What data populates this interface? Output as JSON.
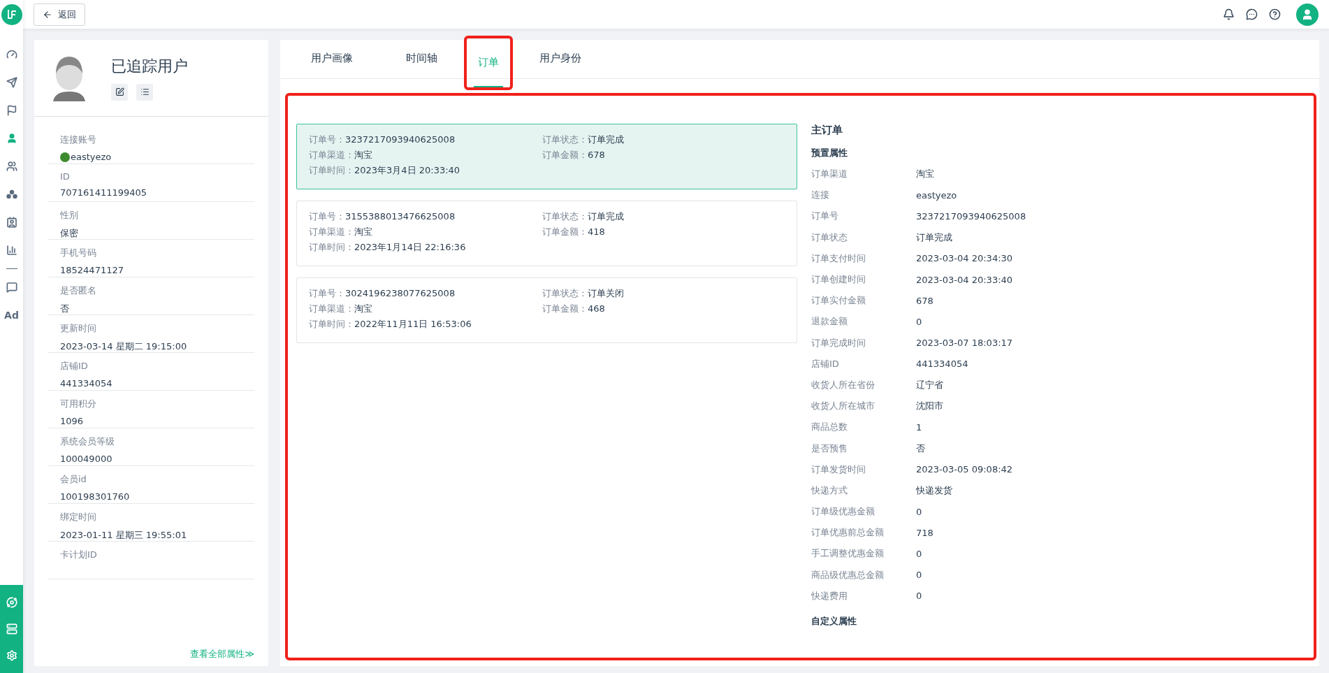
{
  "topbar": {
    "back_button": "返回"
  },
  "nav": {
    "items": [
      {
        "kind": "dashboard",
        "selected": false
      },
      {
        "kind": "send",
        "selected": false
      },
      {
        "kind": "flag",
        "selected": false
      },
      {
        "kind": "user",
        "selected": true
      },
      {
        "kind": "users",
        "selected": false
      },
      {
        "kind": "clusters",
        "selected": false
      },
      {
        "kind": "contact",
        "selected": false
      },
      {
        "kind": "chart",
        "selected": false
      },
      {
        "kind": "divider"
      },
      {
        "kind": "chat",
        "selected": false
      },
      {
        "kind": "text",
        "label": "Ad",
        "selected": false
      }
    ],
    "bottom_items": [
      {
        "kind": "network"
      },
      {
        "kind": "server"
      },
      {
        "kind": "settings"
      }
    ]
  },
  "profile": {
    "title": "已追踪用户",
    "attributes": [
      {
        "label": "连接账号",
        "value": "eastyezo",
        "kind": "account"
      },
      {
        "label": "ID",
        "value": "707161411199405"
      },
      {
        "label": "性别",
        "value": "保密"
      },
      {
        "label": "手机号码",
        "value": "18524471127"
      },
      {
        "label": "是否匿名",
        "value": "否"
      },
      {
        "label": "更新时间",
        "value": "2023-03-14 星期二 19:15:00"
      },
      {
        "label": "店铺ID",
        "value": "441334054"
      },
      {
        "label": "可用积分",
        "value": "1096"
      },
      {
        "label": "系统会员等级",
        "value": "100049000"
      },
      {
        "label": "会员id",
        "value": "100198301760"
      },
      {
        "label": "绑定时间",
        "value": "2023-01-11 星期三 19:55:01"
      },
      {
        "label": "卡计划ID"
      }
    ],
    "view_all": "查看全部属性≫"
  },
  "tabs": [
    {
      "label": "用户画像",
      "selected": false,
      "highlighted": false
    },
    {
      "label": "时间轴",
      "selected": false,
      "highlighted": false
    },
    {
      "label": "订单",
      "selected": true,
      "highlighted": true
    },
    {
      "label": "用户身份",
      "selected": false,
      "highlighted": false
    }
  ],
  "content": {
    "highlighted": true,
    "orders": [
      {
        "selected": true,
        "fields": [
          {
            "label": "订单号：",
            "value": "3237217093940625008"
          },
          {
            "label": "订单状态：",
            "value": "订单完成"
          },
          {
            "label": "订单渠道：",
            "value": "淘宝"
          },
          {
            "label": "订单金额：",
            "value": "678"
          },
          {
            "label": "订单时间：",
            "value": "2023年3月4日 20:33:40"
          }
        ]
      },
      {
        "selected": false,
        "fields": [
          {
            "label": "订单号：",
            "value": "3155388013476625008"
          },
          {
            "label": "订单状态：",
            "value": "订单完成"
          },
          {
            "label": "订单渠道：",
            "value": "淘宝"
          },
          {
            "label": "订单金额：",
            "value": "418"
          },
          {
            "label": "订单时间：",
            "value": "2023年1月14日 22:16:36"
          }
        ]
      },
      {
        "selected": false,
        "fields": [
          {
            "label": "订单号：",
            "value": "3024196238077625008"
          },
          {
            "label": "订单状态：",
            "value": "订单关闭"
          },
          {
            "label": "订单渠道：",
            "value": "淘宝"
          },
          {
            "label": "订单金额：",
            "value": "468"
          },
          {
            "label": "订单时间：",
            "value": "2022年11月11日 16:53:06"
          }
        ]
      }
    ],
    "detail": {
      "title": "主订单",
      "preset_heading": "预置属性",
      "rows": [
        {
          "label": "订单渠道",
          "value": "淘宝"
        },
        {
          "label": "连接",
          "value": "eastyezo"
        },
        {
          "label": "订单号",
          "value": "3237217093940625008"
        },
        {
          "label": "订单状态",
          "value": "订单完成"
        },
        {
          "label": "订单支付时间",
          "value": "2023-03-04 20:34:30"
        },
        {
          "label": "订单创建时间",
          "value": "2023-03-04 20:33:40"
        },
        {
          "label": "订单实付金额",
          "value": "678"
        },
        {
          "label": "退款金额",
          "value": "0"
        },
        {
          "label": "订单完成时间",
          "value": "2023-03-07 18:03:17"
        },
        {
          "label": "店铺ID",
          "value": "441334054"
        },
        {
          "label": "收货人所在省份",
          "value": "辽宁省"
        },
        {
          "label": "收货人所在城市",
          "value": "沈阳市"
        },
        {
          "label": "商品总数",
          "value": "1"
        },
        {
          "label": "是否预售",
          "value": "否"
        },
        {
          "label": "订单发货时间",
          "value": "2023-03-05 09:08:42"
        },
        {
          "label": "快递方式",
          "value": "快递发货"
        },
        {
          "label": "订单级优惠金额",
          "value": "0"
        },
        {
          "label": "订单优惠前总金额",
          "value": "718"
        },
        {
          "label": "手工调整优惠金额",
          "value": "0"
        },
        {
          "label": "商品级优惠总金额",
          "value": "0"
        },
        {
          "label": "快递费用",
          "value": "0"
        }
      ],
      "custom_heading": "自定义属性"
    }
  }
}
